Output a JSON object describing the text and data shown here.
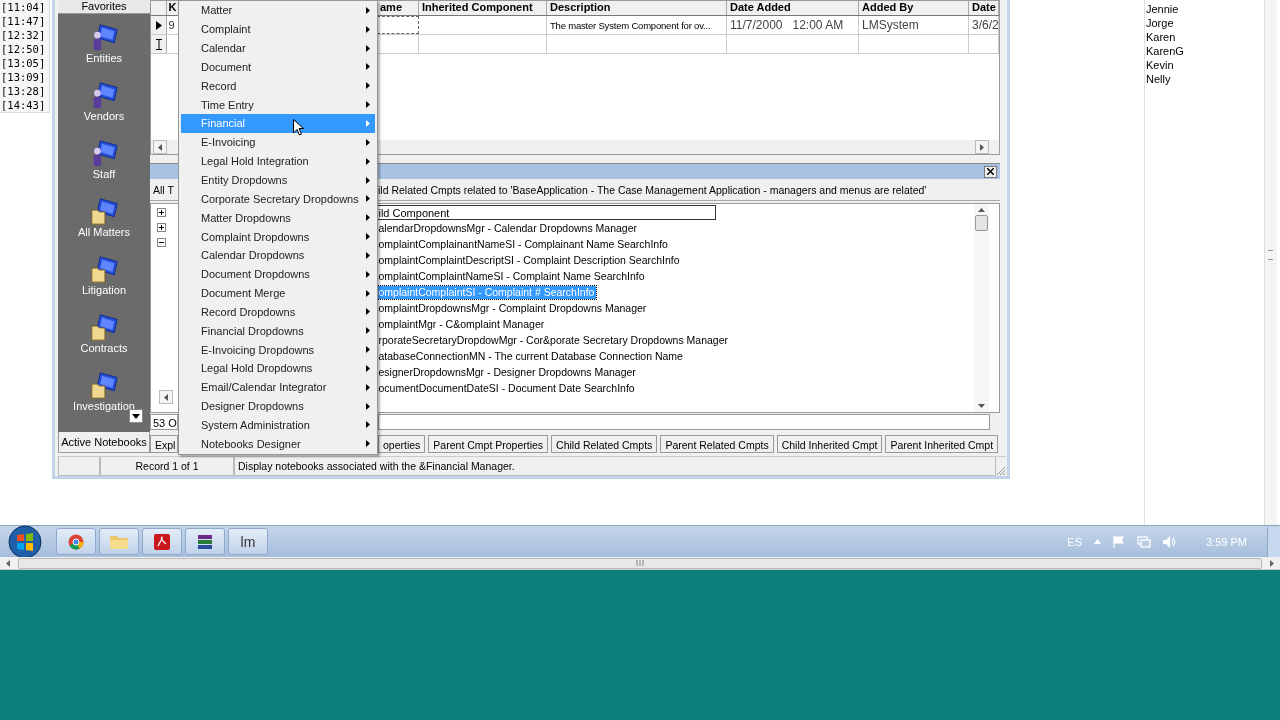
{
  "timestamps": [
    "[11:04]",
    "[11:47]",
    "[12:32]",
    "[12:50]",
    "[13:05]",
    "[13:09]",
    "[13:28]",
    "[14:43]"
  ],
  "app": {
    "nav": {
      "header": "Favorites",
      "items": [
        {
          "label": "Entities",
          "kind": "person"
        },
        {
          "label": "Vendors",
          "kind": "person"
        },
        {
          "label": "Staff",
          "kind": "person"
        },
        {
          "label": "All Matters",
          "kind": "folder"
        },
        {
          "label": "Litigation",
          "kind": "folder"
        },
        {
          "label": "Contracts",
          "kind": "folder"
        },
        {
          "label": "Investigation",
          "kind": "folder"
        }
      ],
      "bottom_tab": "Active Notebooks"
    },
    "grid": {
      "columns": [
        "K",
        "ame",
        "Inherited Component",
        "Description",
        "Date Added",
        "Added By",
        "Date"
      ],
      "rows": [
        {
          "current": true,
          "cells": [
            "9",
            "",
            "",
            "The master System Component for ov...",
            "11/7/2000   12:00 AM",
            "LMSystem",
            "3/6/2"
          ]
        },
        {
          "current": false,
          "cells": []
        }
      ]
    },
    "panel": {
      "caption_left": "All T",
      "caption": "ild Related Cmpts related to 'BaseApplication - The Case Management Application - managers and menus are related'",
      "tree_nodes": [
        {
          "expanded": false
        },
        {
          "expanded": false
        },
        {
          "expanded": true
        }
      ],
      "list_header": "ild Component",
      "items": [
        {
          "label": "alendarDropdownsMgr - Calendar Dropdowns Manager",
          "selected": false
        },
        {
          "label": "omplaintComplainantNameSI - Complainant Name SearchInfo",
          "selected": false
        },
        {
          "label": "omplaintComplaintDescriptSI - Complaint Description SearchInfo",
          "selected": false
        },
        {
          "label": "omplaintComplaintNameSI - Complaint Name SearchInfo",
          "selected": false
        },
        {
          "label": "omplaintComplaintSI - Complaint # SearchInfo",
          "selected": true
        },
        {
          "label": "omplaintDropdownsMgr - Complaint Dropdowns Manager",
          "selected": false
        },
        {
          "label": "omplaintMgr - C&omplaint Manager",
          "selected": false
        },
        {
          "label": "rporateSecretaryDropdowMgr - Cor&porate Secretary Dropdowns Manager",
          "selected": false
        },
        {
          "label": "atabaseConnectionMN - The current Database Connection Name",
          "selected": false
        },
        {
          "label": "esignerDropdownsMgr - Designer Dropdowns Manager",
          "selected": false
        },
        {
          "label": "ocumentDocumentDateSI - Document Date SearchInfo",
          "selected": false
        }
      ],
      "field": "53 O"
    },
    "tabs": [
      {
        "label": "Expl",
        "selected": false
      },
      {
        "label": "operties",
        "selected": false
      },
      {
        "label": "Parent Cmpt Properties",
        "selected": false
      },
      {
        "label": "Child Related Cmpts",
        "selected": false
      },
      {
        "label": "Parent Related Cmpts",
        "selected": false
      },
      {
        "label": "Child Inherited Cmpt",
        "selected": false
      },
      {
        "label": "Parent Inherited Cmpt",
        "selected": false
      }
    ],
    "status": {
      "record": "Record 1 of 1",
      "message": "Display notebooks associated with the &Financial Manager."
    },
    "menu": {
      "items": [
        {
          "label": "Matter",
          "selected": false
        },
        {
          "label": "Complaint",
          "selected": false
        },
        {
          "label": "Calendar",
          "selected": false
        },
        {
          "label": "Document",
          "selected": false
        },
        {
          "label": "Record",
          "selected": false
        },
        {
          "label": "Time Entry",
          "selected": false
        },
        {
          "label": "Financial",
          "selected": true
        },
        {
          "label": "E-Invoicing",
          "selected": false
        },
        {
          "label": "Legal Hold Integration",
          "selected": false
        },
        {
          "label": "Entity Dropdowns",
          "selected": false
        },
        {
          "label": "Corporate Secretary Dropdowns",
          "selected": false
        },
        {
          "label": "Matter Dropdowns",
          "selected": false
        },
        {
          "label": "Complaint Dropdowns",
          "selected": false
        },
        {
          "label": "Calendar Dropdowns",
          "selected": false
        },
        {
          "label": "Document Dropdowns",
          "selected": false
        },
        {
          "label": "Document Merge",
          "selected": false
        },
        {
          "label": "Record Dropdowns",
          "selected": false
        },
        {
          "label": "Financial Dropdowns",
          "selected": false
        },
        {
          "label": "E-Invoicing Dropdowns",
          "selected": false
        },
        {
          "label": "Legal Hold Dropdowns",
          "selected": false
        },
        {
          "label": "Email/Calendar Integrator",
          "selected": false
        },
        {
          "label": "Designer Dropdowns",
          "selected": false
        },
        {
          "label": "System Administration",
          "selected": false
        },
        {
          "label": "Notebooks Designer",
          "selected": false
        }
      ]
    }
  },
  "users": [
    "Jennie",
    "Jorge",
    "Karen",
    "KarenG",
    "Kevin",
    "Nelly"
  ],
  "taskbar": {
    "apps": [
      {
        "kind": "chrome"
      },
      {
        "kind": "folder"
      },
      {
        "kind": "pdf"
      },
      {
        "kind": "archive"
      },
      {
        "kind": "text",
        "label": "lm"
      }
    ],
    "tray": {
      "language": "ES",
      "time": "3:59 PM"
    }
  }
}
